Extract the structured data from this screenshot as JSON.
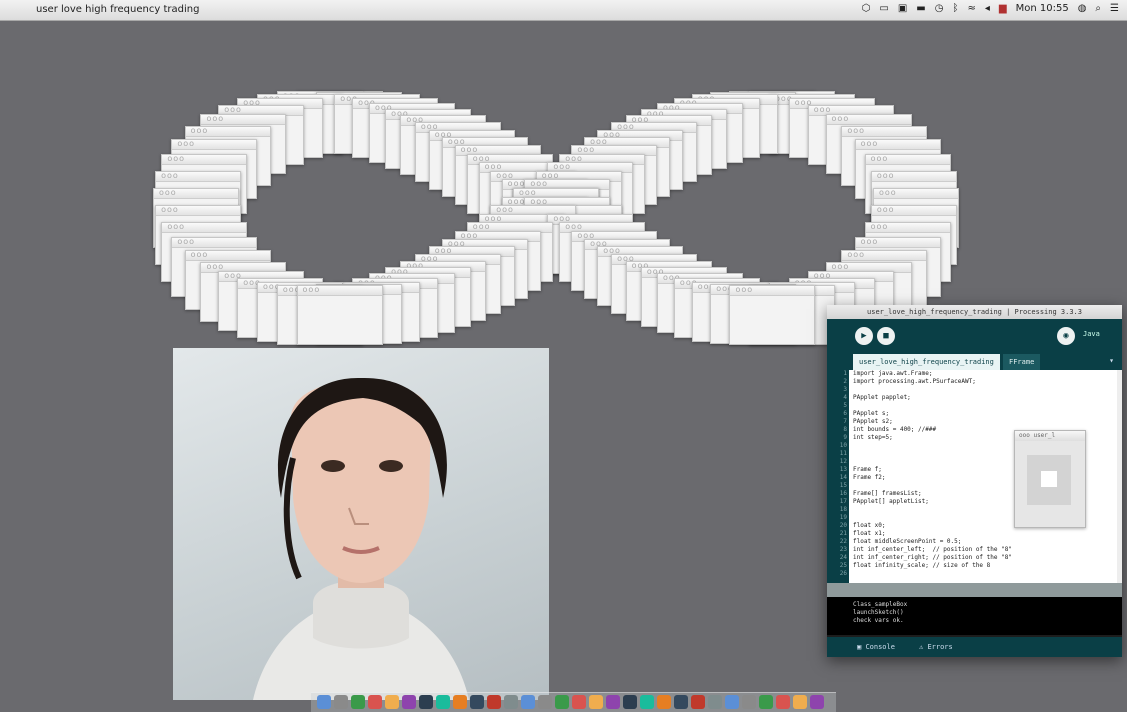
{
  "menubar": {
    "app_name": "user love high frequency trading",
    "status_icons": [
      "dropbox-icon",
      "monitor-icon",
      "display-icon",
      "battery-icon",
      "timer-icon",
      "bluetooth-icon",
      "wifi-icon",
      "volume-icon",
      "flag-icon",
      "Mon 10:55",
      "user-icon",
      "search-icon",
      "list-icon"
    ],
    "clock": "Mon 10:55"
  },
  "windows": {
    "count": 100,
    "traffic_lights": "ooo"
  },
  "ide": {
    "title": "user_love_high_frequency_trading | Processing 3.3.3",
    "mode_label": "Java",
    "tabs": [
      "user_love_high_frequency_trading",
      "FFrame"
    ],
    "line_numbers": [
      "1",
      "2",
      "3",
      "4",
      "5",
      "6",
      "7",
      "8",
      "9",
      "10",
      "11",
      "12",
      "13",
      "14",
      "15",
      "16",
      "17",
      "18",
      "19",
      "20",
      "21",
      "22",
      "23",
      "24",
      "25",
      "26"
    ],
    "code_lines": [
      "import java.awt.Frame;",
      "import processing.awt.PSurfaceAWT;",
      "",
      "PApplet papplet;",
      "",
      "PApplet s;",
      "PApplet s2;",
      "int bounds = 400; //###",
      "int step=5;",
      "",
      "",
      "",
      "Frame f;",
      "Frame f2;",
      "",
      "Frame[] framesList;",
      "PApplet[] appletList;",
      "",
      "",
      "float x0;",
      "float x1;",
      "float middleScreenPoint = 0.5;",
      "int inf_center_left;  // position of the \"8\"",
      "int inf_center_right; // position of the \"8\"",
      "float infinity_scale; // size of the 8",
      ""
    ],
    "console_lines": [
      "Class_sampleBox",
      "launchSketch()",
      "check vars ok."
    ],
    "footer_console": "Console",
    "footer_errors": "Errors",
    "mini_window_title": "user_l"
  },
  "dock": {
    "icon_count": 30
  }
}
